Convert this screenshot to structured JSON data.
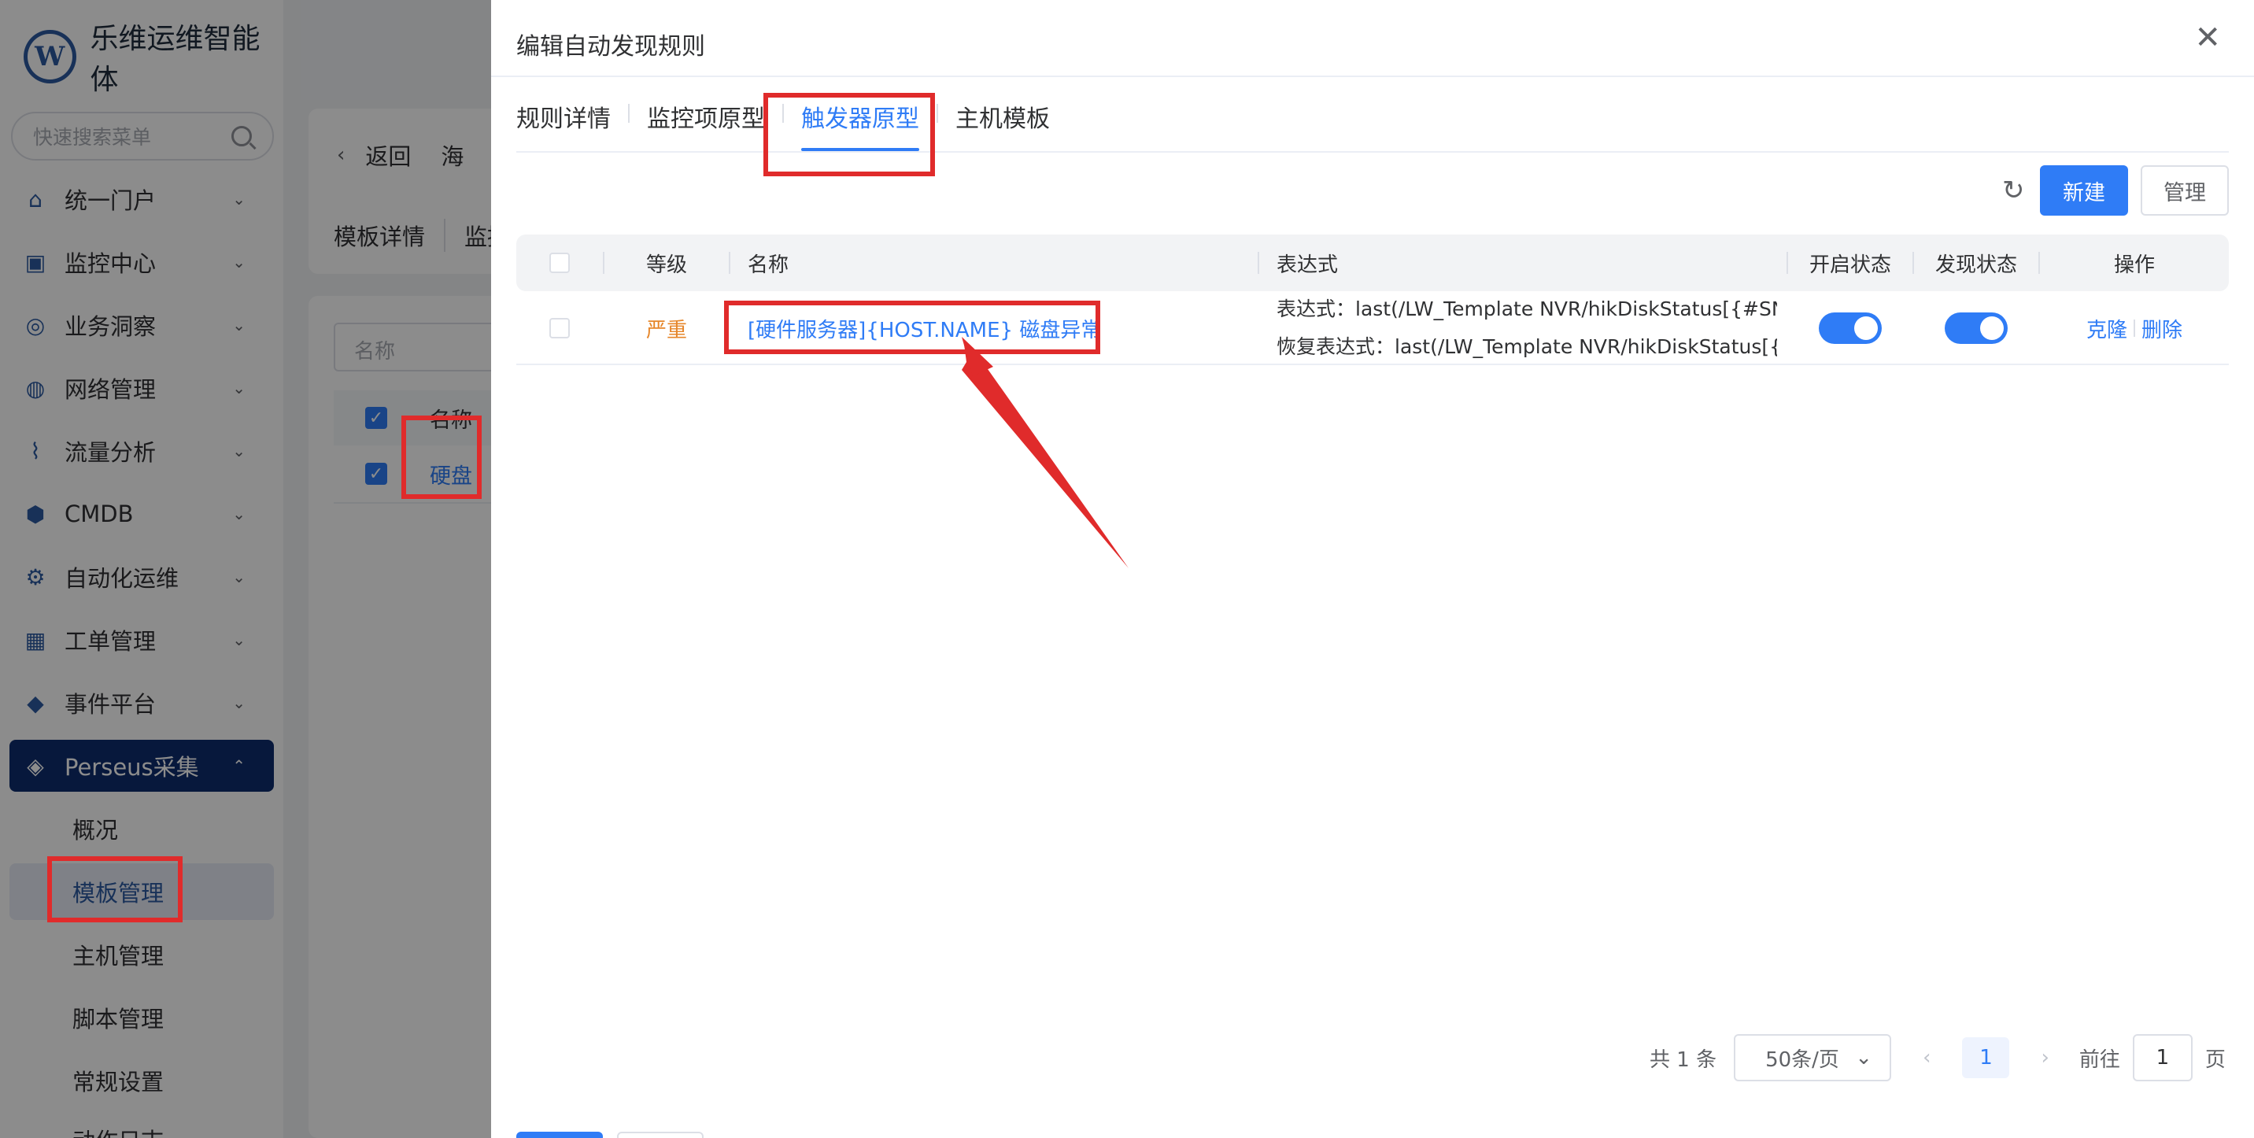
{
  "app": {
    "name": "乐维运维智能体",
    "logo_text": "W",
    "search_placeholder": "快速搜索菜单"
  },
  "sidebar": {
    "menu": [
      {
        "label": "统一门户",
        "icon": "home-icon"
      },
      {
        "label": "监控中心",
        "icon": "monitor-icon"
      },
      {
        "label": "业务洞察",
        "icon": "insight-icon"
      },
      {
        "label": "网络管理",
        "icon": "globe-icon"
      },
      {
        "label": "流量分析",
        "icon": "chart-icon"
      },
      {
        "label": "CMDB",
        "icon": "cube-icon"
      },
      {
        "label": "自动化运维",
        "icon": "gear-icon"
      },
      {
        "label": "工单管理",
        "icon": "calendar-icon"
      },
      {
        "label": "事件平台",
        "icon": "bell-icon"
      },
      {
        "label": "Perseus采集",
        "icon": "perseus-icon"
      }
    ],
    "submenu": [
      "概况",
      "模板管理",
      "主机管理",
      "脚本管理",
      "常规设置",
      "动作日志"
    ]
  },
  "background": {
    "back_label": "返回",
    "page_title": "海",
    "tabs": [
      "模板详情",
      "监控"
    ],
    "filter_placeholder": "名称",
    "table_header": "名称",
    "row_value": "硬盘"
  },
  "drawer": {
    "title": "编辑自动发现规则",
    "tabs": [
      "规则详情",
      "监控项原型",
      "触发器原型",
      "主机模板"
    ],
    "active_tab": "触发器原型",
    "toolbar": {
      "new_label": "新建",
      "manage_label": "管理"
    },
    "table": {
      "headers": {
        "level": "等级",
        "name": "名称",
        "expression": "表达式",
        "enabled": "开启状态",
        "discover": "发现状态",
        "ops": "操作"
      },
      "rows": [
        {
          "level": "严重",
          "name": "[硬件服务器]{HOST.NAME} 磁盘异常",
          "expression": "表达式：last(/LW_Template NVR/hikDiskStatus[{#SNMPI",
          "recovery_expression": "恢复表达式：last(/LW_Template NVR/hikDiskStatus[{#SNI",
          "enabled": true,
          "discover": true,
          "op_clone": "克隆",
          "op_delete": "删除"
        }
      ]
    },
    "pagination": {
      "total": "共 1 条",
      "page_size": "50条/页",
      "current_page": "1",
      "goto_label": "前往",
      "goto_value": "1",
      "page_suffix": "页"
    }
  },
  "colors": {
    "primary": "#2f7cf6",
    "sidebar_active": "#0d2c6e",
    "severity_serious": "#e6862a",
    "annotation_red": "#e02b2b"
  }
}
